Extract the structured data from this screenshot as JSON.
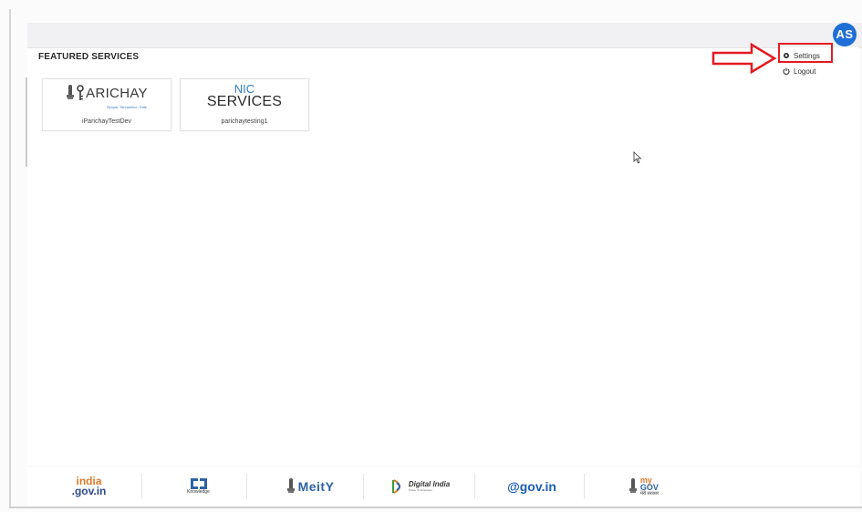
{
  "header": {
    "avatar_initials": "AS",
    "accent_color": "#1f6fd6"
  },
  "featured": {
    "title": "FEATURED SERVICES",
    "cards": [
      {
        "logo_text": "ARICHAY",
        "logo_icon": "key-emblem-icon",
        "tagline": "Simple, Streamline, Safe",
        "label": "PARICHAY"
      },
      {
        "logo_top": "NIC",
        "logo_bottom": "SERVICES",
        "label": "parichaytesting1"
      }
    ],
    "card_1_label": "iParichayTestDev"
  },
  "user_menu": {
    "settings_label": "Settings",
    "logout_label": "Logout",
    "settings_icon": "gear-icon",
    "logout_icon": "power-icon"
  },
  "annotation": {
    "highlight_color": "#e31b23"
  },
  "footer": {
    "india_gov_line1": "india",
    "india_gov_line2": ".gov.in",
    "nk_line1": "Knowledge",
    "meity_label": "MeitY",
    "digital_india_line1": "Digital India",
    "digital_india_line2": "Power To Empower",
    "gov_in_label": "@gov.in",
    "mygov_line1": "my",
    "mygov_line2": "GOV",
    "mygov_line3": "मेरी सरकार"
  }
}
